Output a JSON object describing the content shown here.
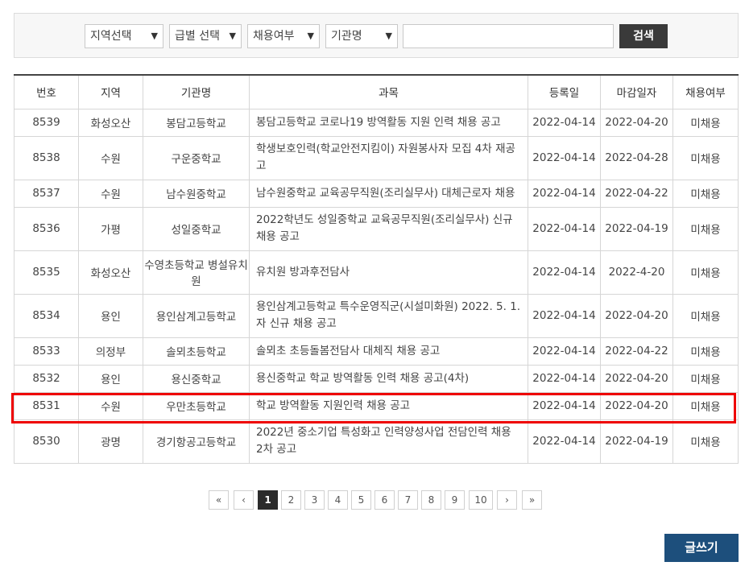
{
  "search": {
    "region_select": "지역선택",
    "level_select": "급별 선택",
    "hire_select": "채용여부",
    "org_select": "기관명",
    "keyword_value": "",
    "search_label": "검색"
  },
  "table": {
    "headers": [
      "번호",
      "지역",
      "기관명",
      "과목",
      "등록일",
      "마감일자",
      "채용여부"
    ],
    "rows": [
      {
        "no": "8539",
        "region": "화성오산",
        "org": "봉담고등학교",
        "subject": "봉담고등학교 코로나19 방역활동 지원 인력 채용 공고",
        "reg": "2022-04-14",
        "due": "2022-04-20",
        "status": "미채용"
      },
      {
        "no": "8538",
        "region": "수원",
        "org": "구운중학교",
        "subject": "학생보호인력(학교안전지킴이) 자원봉사자 모집 4차 재공고",
        "reg": "2022-04-14",
        "due": "2022-04-28",
        "status": "미채용"
      },
      {
        "no": "8537",
        "region": "수원",
        "org": "남수원중학교",
        "subject": "남수원중학교 교육공무직원(조리실무사) 대체근로자 채용",
        "reg": "2022-04-14",
        "due": "2022-04-22",
        "status": "미채용"
      },
      {
        "no": "8536",
        "region": "가평",
        "org": "성일중학교",
        "subject": "2022학년도 성일중학교 교육공무직원(조리실무사) 신규 채용 공고",
        "reg": "2022-04-14",
        "due": "2022-04-19",
        "status": "미채용"
      },
      {
        "no": "8535",
        "region": "화성오산",
        "org": "수영초등학교 병설유치원",
        "subject": "유치원 방과후전담사",
        "reg": "2022-04-14",
        "due": "2022-4-20",
        "status": "미채용"
      },
      {
        "no": "8534",
        "region": "용인",
        "org": "용인삼계고등학교",
        "subject": "용인삼계고등학교 특수운영직군(시설미화원) 2022. 5. 1.자 신규 채용 공고",
        "reg": "2022-04-14",
        "due": "2022-04-20",
        "status": "미채용"
      },
      {
        "no": "8533",
        "region": "의정부",
        "org": "솔뫼초등학교",
        "subject": "솔뫼초 초등돌봄전담사 대체직 채용 공고",
        "reg": "2022-04-14",
        "due": "2022-04-22",
        "status": "미채용"
      },
      {
        "no": "8532",
        "region": "용인",
        "org": "용신중학교",
        "subject": "용신중학교 학교 방역활동 인력 채용 공고(4차)",
        "reg": "2022-04-14",
        "due": "2022-04-20",
        "status": "미채용"
      },
      {
        "no": "8531",
        "region": "수원",
        "org": "우만초등학교",
        "subject": "학교 방역활동 지원인력 채용 공고",
        "reg": "2022-04-14",
        "due": "2022-04-20",
        "status": "미채용"
      },
      {
        "no": "8530",
        "region": "광명",
        "org": "경기항공고등학교",
        "subject": "2022년 중소기업 특성화고 인력양성사업 전담인력 채용 2차 공고",
        "reg": "2022-04-14",
        "due": "2022-04-19",
        "status": "미채용"
      }
    ]
  },
  "pagination": {
    "first": "«",
    "prev": "‹",
    "pages": [
      "1",
      "2",
      "3",
      "4",
      "5",
      "6",
      "7",
      "8",
      "9",
      "10"
    ],
    "current": "1",
    "next": "›",
    "last": "»"
  },
  "write_label": "글쓰기",
  "colors": {
    "highlight": "#e00000",
    "write_button": "#1d4f7c",
    "search_button": "#3a3a3a"
  }
}
